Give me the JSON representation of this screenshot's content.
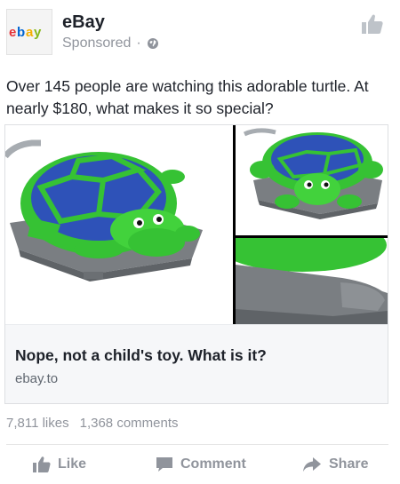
{
  "header": {
    "avatar_logo": "ebay",
    "page_name": "eBay",
    "sponsored": "Sponsored",
    "separator": "·",
    "icons": {
      "privacy": "globe-icon",
      "like_top": "thumbs-up-icon"
    }
  },
  "post": {
    "text": "Over 145 people are watching this adorable turtle. At nearly $180, what makes it so special?"
  },
  "card": {
    "title": "Nope, not a child's toy. What is it?",
    "domain": "ebay.to",
    "images": [
      "turtle-main",
      "turtle-front",
      "turtle-base-closeup"
    ]
  },
  "stats": {
    "likes": "7,811 likes",
    "comments": "1,368 comments"
  },
  "actions": {
    "like": "Like",
    "comment": "Comment",
    "share": "Share"
  },
  "colors": {
    "text": "#1d2129",
    "muted": "#90949c",
    "shell_blue": "#2e52b8",
    "shell_green": "#36c234",
    "base_gray": "#7a7e82",
    "ebay_red": "#e53238",
    "ebay_blue": "#0064d2",
    "ebay_yellow": "#f5af02",
    "ebay_green": "#86b817"
  }
}
